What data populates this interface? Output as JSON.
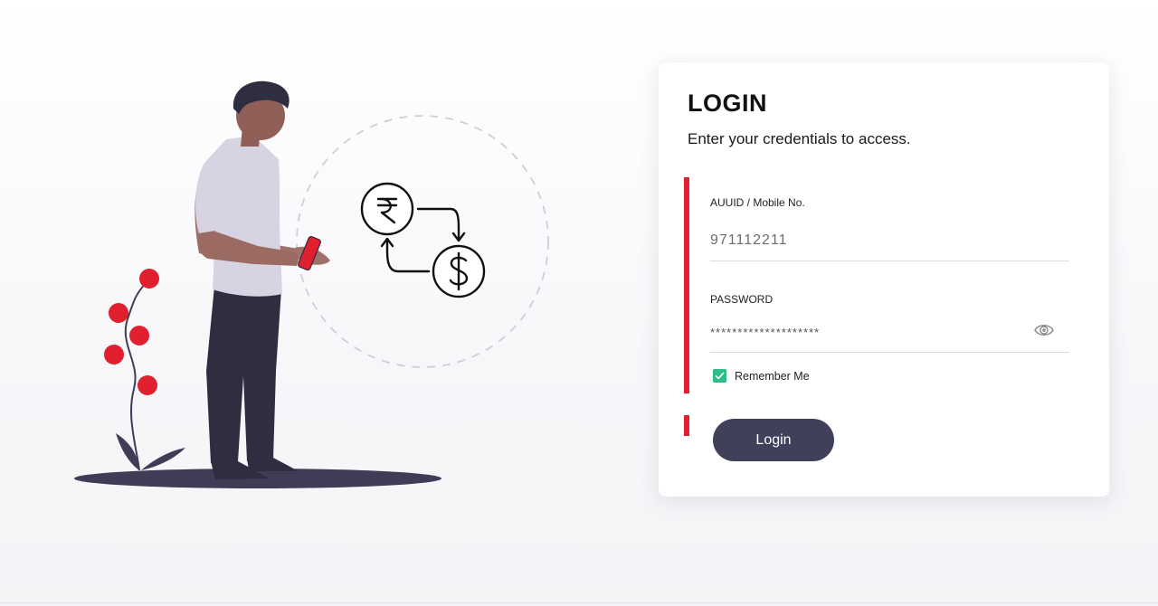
{
  "login": {
    "title": "LOGIN",
    "subtitle": "Enter your credentials to access.",
    "uid_label": "AUUID / Mobile No.",
    "uid_value": "971112211",
    "password_label": "PASSWORD",
    "password_value": "********************",
    "remember_label": "Remember Me",
    "remember_checked": true,
    "login_button": "Login"
  },
  "colors": {
    "accent": "#e0202e",
    "button": "#40405a",
    "checkbox": "#2ebd84"
  },
  "icons": {
    "password_toggle": "eye-icon",
    "checkbox": "check-icon",
    "exchange": "rupee-dollar-exchange-icon"
  }
}
